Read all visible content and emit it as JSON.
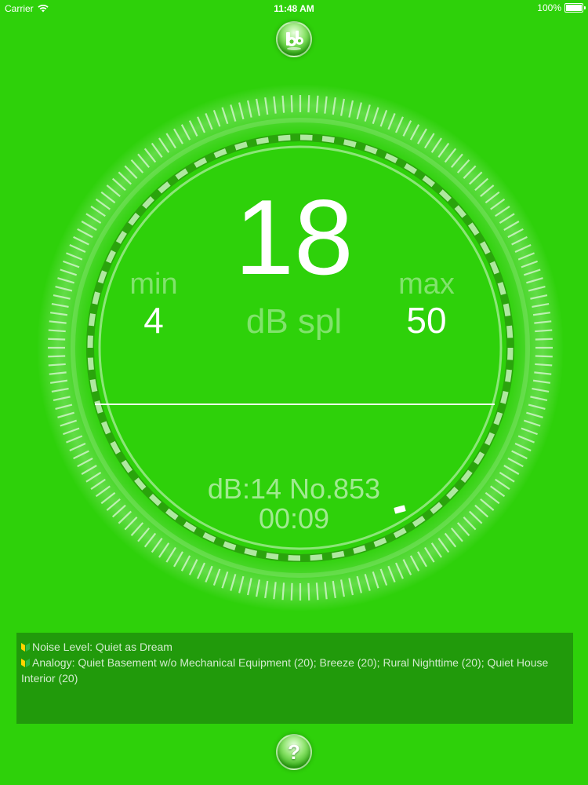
{
  "status_bar": {
    "carrier": "Carrier",
    "time": "11:48 AM",
    "battery": "100%",
    "battery_level": 1.0
  },
  "header": {
    "logo_icon": "db-logo-icon"
  },
  "meter": {
    "value": "18",
    "unit": "dB spl",
    "min_label": "min",
    "min_value": "4",
    "max_label": "max",
    "max_value": "50",
    "sample_info": "dB:14 No.853",
    "elapsed": "00:09"
  },
  "info": {
    "noise_level": "Noise Level: Quiet as Dream",
    "analogy": "Analogy: Quiet Basement w/o Mechanical Equipment (20); Breeze (20); Rural Nighttime (20); Quiet House Interior (20)"
  },
  "footer": {
    "help_label": "?"
  },
  "colors": {
    "background": "#2ed10a",
    "panel": "#219a0b",
    "text": "#ffffff"
  }
}
